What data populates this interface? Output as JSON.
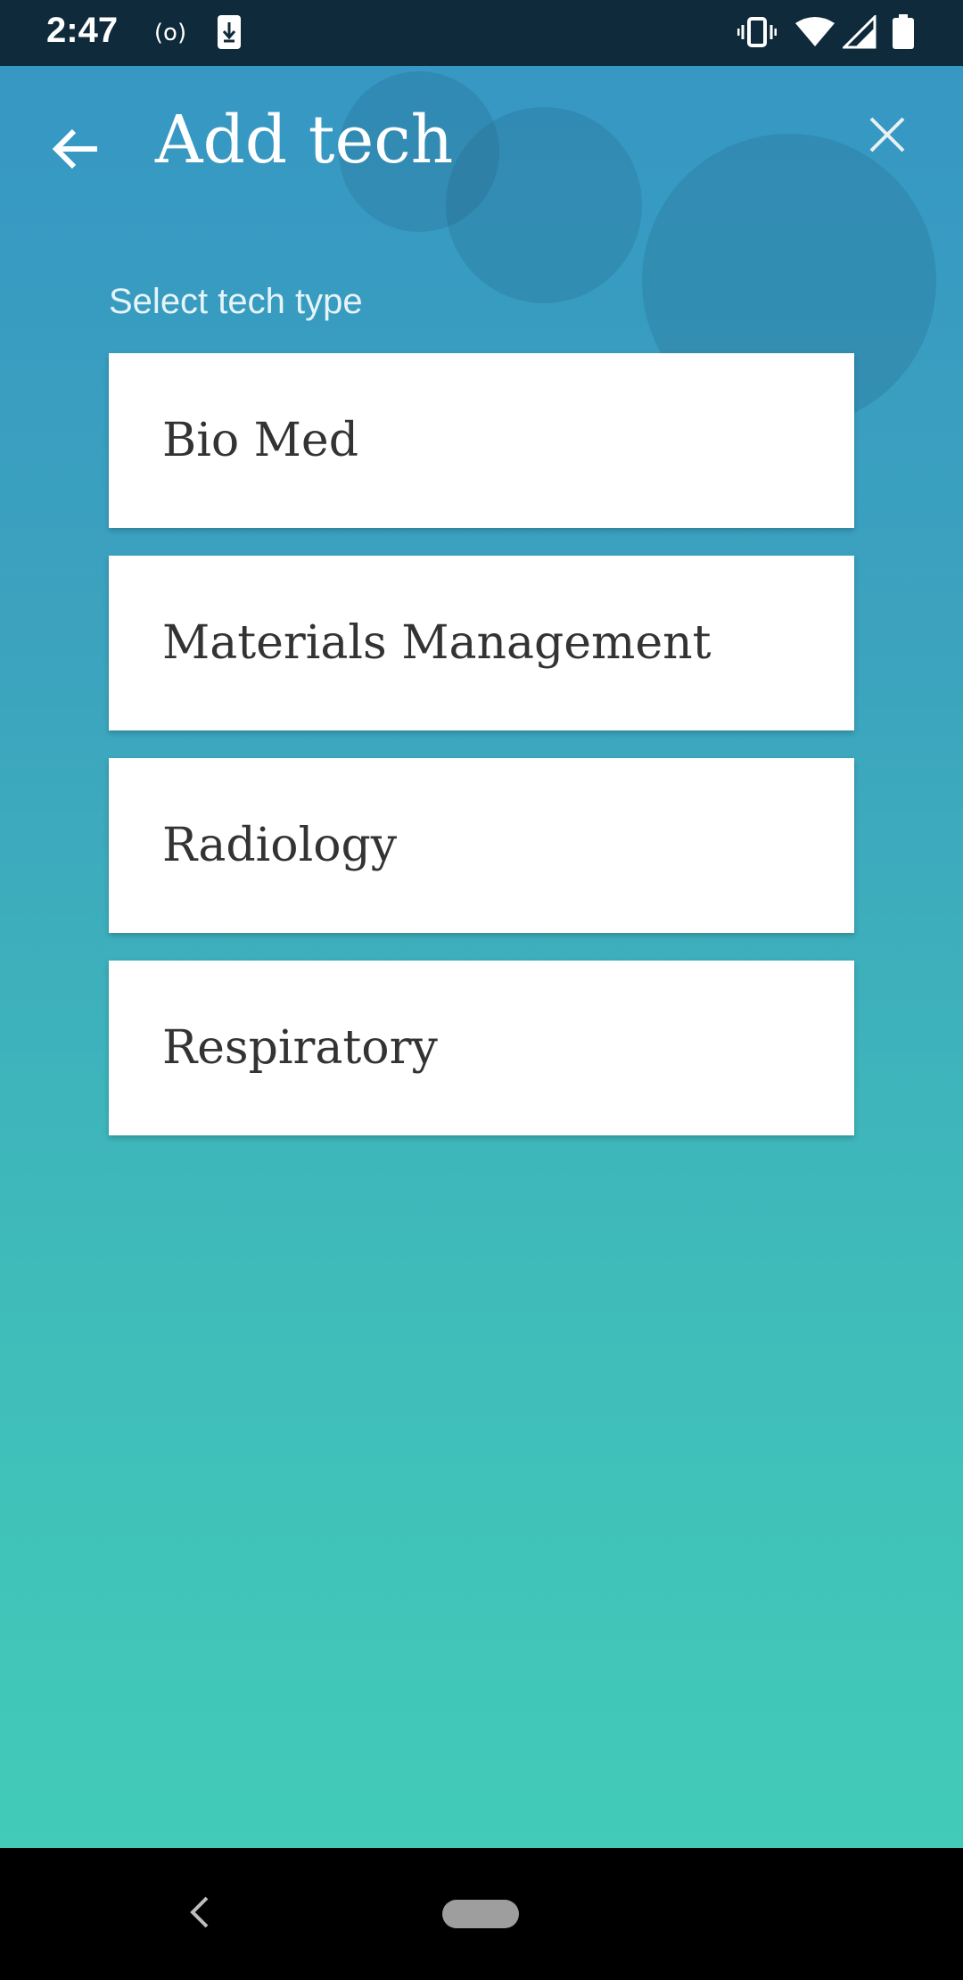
{
  "status_bar": {
    "time": "2:47",
    "icons": [
      "hotspot-icon",
      "download-icon",
      "vibrate-icon",
      "wifi-icon",
      "signal-icon",
      "battery-icon"
    ]
  },
  "app_bar": {
    "title": "Add tech",
    "back_icon": "arrow-back-icon",
    "close_icon": "close-icon"
  },
  "section": {
    "label": "Select tech type"
  },
  "options": [
    {
      "label": "Bio Med"
    },
    {
      "label": "Materials Management"
    },
    {
      "label": "Radiology"
    },
    {
      "label": "Respiratory"
    }
  ],
  "nav_bar": {
    "back_icon": "nav-back-icon",
    "home_icon": "home-pill-icon"
  },
  "colors": {
    "gradient_top": "#3596c4",
    "gradient_bottom": "#42cbb8",
    "status_bar": "#0f2a3a",
    "card": "#ffffff",
    "card_text": "#333333"
  }
}
